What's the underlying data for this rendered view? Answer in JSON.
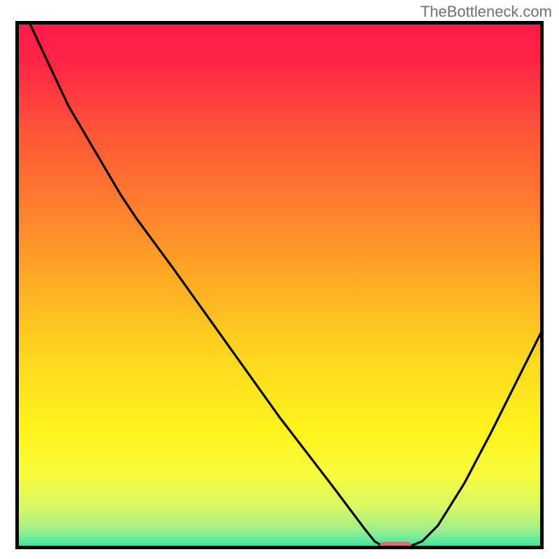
{
  "watermark": "TheBottleneck.com",
  "chart_data": {
    "type": "line",
    "title": "",
    "xlabel": "",
    "ylabel": "",
    "xlim": [
      0,
      100
    ],
    "ylim": [
      0,
      100
    ],
    "background_gradient": {
      "stops": [
        {
          "offset": 0.0,
          "color": "#ff1a4a"
        },
        {
          "offset": 0.08,
          "color": "#ff2545"
        },
        {
          "offset": 0.2,
          "color": "#ff5238"
        },
        {
          "offset": 0.35,
          "color": "#ff7e2e"
        },
        {
          "offset": 0.5,
          "color": "#ffae24"
        },
        {
          "offset": 0.65,
          "color": "#ffda1f"
        },
        {
          "offset": 0.78,
          "color": "#fff41d"
        },
        {
          "offset": 0.86,
          "color": "#f7fb3c"
        },
        {
          "offset": 0.92,
          "color": "#d8f864"
        },
        {
          "offset": 0.96,
          "color": "#a4f088"
        },
        {
          "offset": 0.985,
          "color": "#5ee89f"
        },
        {
          "offset": 1.0,
          "color": "#22d9a0"
        }
      ]
    },
    "series": [
      {
        "name": "bottleneck-curve",
        "color": "#000000",
        "points": [
          {
            "x": 2.5,
            "y": 100.0
          },
          {
            "x": 10.0,
            "y": 84.0
          },
          {
            "x": 20.0,
            "y": 67.0
          },
          {
            "x": 23.0,
            "y": 62.5
          },
          {
            "x": 30.0,
            "y": 53.0
          },
          {
            "x": 40.0,
            "y": 39.0
          },
          {
            "x": 50.0,
            "y": 25.0
          },
          {
            "x": 60.0,
            "y": 12.0
          },
          {
            "x": 66.0,
            "y": 4.0
          },
          {
            "x": 68.0,
            "y": 1.5
          },
          {
            "x": 70.0,
            "y": 0.3
          },
          {
            "x": 74.0,
            "y": 0.3
          },
          {
            "x": 77.0,
            "y": 1.5
          },
          {
            "x": 80.0,
            "y": 4.5
          },
          {
            "x": 85.0,
            "y": 12.5
          },
          {
            "x": 90.0,
            "y": 22.0
          },
          {
            "x": 95.0,
            "y": 32.0
          },
          {
            "x": 100.0,
            "y": 42.0
          }
        ]
      }
    ],
    "marker": {
      "name": "optimal-marker",
      "x": 72,
      "y": 0.3,
      "color": "#e36a6a",
      "width": 6,
      "height": 2.2
    }
  }
}
